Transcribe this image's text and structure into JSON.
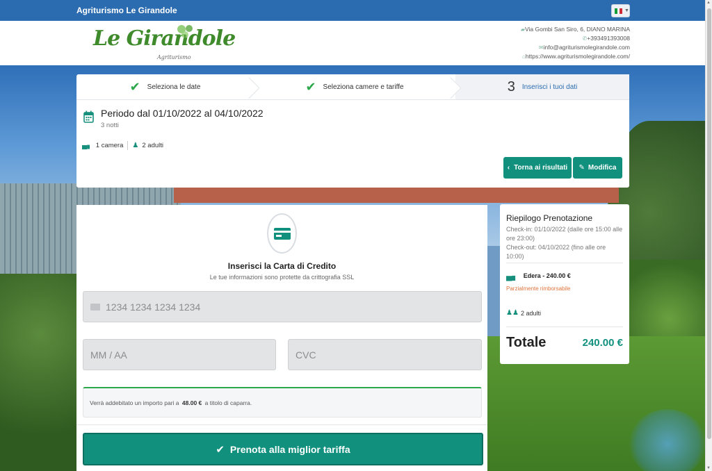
{
  "topbar": {
    "brand": "Agriturismo Le Girandole",
    "language": "Italiano"
  },
  "header": {
    "logo_text": "Le Girandole",
    "logo_sub": "Agriturismo",
    "address": "Via Gombi San Siro, 6, DIANO MARINA",
    "phone": "+393491393008",
    "email": "info@agriturismolegirandole.com",
    "website": "https://www.agriturismolegirandole.com/"
  },
  "steps": [
    {
      "label": "Seleziona le date",
      "state": "done"
    },
    {
      "label": "Seleziona camere e tariffe",
      "state": "done"
    },
    {
      "number": "3",
      "label": "Inserisci i tuoi dati",
      "state": "active"
    }
  ],
  "booking": {
    "period": "Periodo dal 01/10/2022 al 04/10/2022",
    "nights": "3 notti",
    "rooms": "1 camera",
    "guests": "2 adulti",
    "back_label": "Torna ai risultati",
    "edit_label": "Modifica"
  },
  "payment": {
    "title": "Inserisci la Carta di Credito",
    "subtitle": "Le tue informazioni sono protette da crittografia SSL",
    "card_placeholder": "1234 1234 1234 1234",
    "expiry_placeholder": "MM / AA",
    "cvc_placeholder": "CVC",
    "note_prefix": "Verrà addebitato un importo pari a",
    "note_amount": "48.00 €",
    "note_suffix": "a titolo di caparra.",
    "book_label": "Prenota alla miglior tariffa"
  },
  "summary": {
    "title": "Riepilogo Prenotazione",
    "checkin": "Check-in: 01/10/2022 (dalle ore 15:00 alle ore 23:00)",
    "checkout": "Check-out: 04/10/2022 (fino alle ore 10:00)",
    "room": "Edera - 240.00 €",
    "refund": "Parzialmente rimborsabile",
    "guests": "2 adulti",
    "total_label": "Totale",
    "total_value": "240.00 €"
  },
  "colors": {
    "primary": "#11907e",
    "topbar": "#2b6cb0",
    "check": "#2aa84a",
    "refund": "#e0743c"
  }
}
